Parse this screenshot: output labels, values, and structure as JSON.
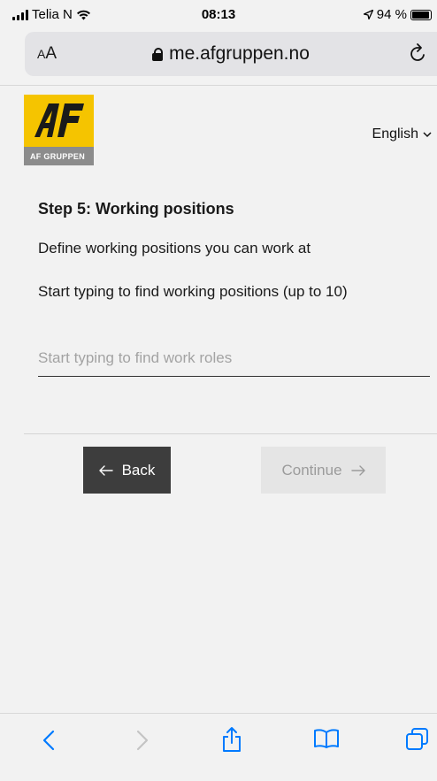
{
  "status": {
    "carrier": "Telia N",
    "time": "08:13",
    "battery": "94 %",
    "battery_level": 0.94
  },
  "browser": {
    "text_size_label": "AA",
    "url": "me.afgruppen.no",
    "icons": [
      "lock-icon",
      "reload-icon",
      "back-icon",
      "forward-icon",
      "share-icon",
      "bookmarks-icon",
      "tabs-icon"
    ]
  },
  "page": {
    "logo_text": "AF GRUPPEN",
    "language": "English",
    "step_title": "Step 5: Working positions",
    "description": "Define working positions you can work at",
    "instruction": "Start typing to find working positions (up to 10)",
    "search": {
      "value": "",
      "placeholder": "Start typing to find work roles"
    },
    "back_label": "Back",
    "continue_label": "Continue"
  },
  "colors": {
    "brand_yellow": "#f5c400",
    "back_button": "#3d3d3d",
    "ios_blue": "#007aff"
  }
}
